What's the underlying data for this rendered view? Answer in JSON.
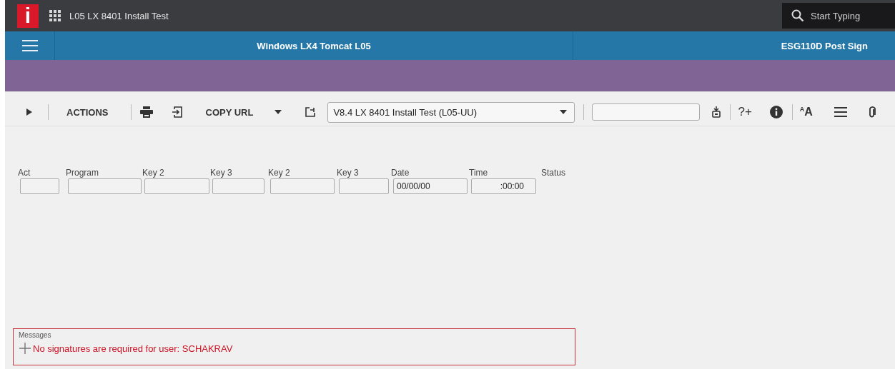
{
  "top_bar": {
    "logo": "i",
    "title": "L05 LX 8401 Install Test",
    "search": {
      "placeholder": "Start Typing"
    }
  },
  "nav_bar": {
    "center_title": "Windows LX4 Tomcat L05",
    "right_title": "ESG110D Post Sign"
  },
  "toolbar": {
    "actions": "ACTIONS",
    "copy_url": "COPY URL",
    "environment": "V8.4 LX 8401 Install Test (L05-UU)",
    "help": "?+",
    "text_size": {
      "small": "A",
      "large": "A"
    }
  },
  "fields": [
    {
      "label": "Act",
      "kind": "text"
    },
    {
      "label": "Program",
      "kind": "text"
    },
    {
      "label": "Key 2",
      "kind": "text"
    },
    {
      "label": "Key 3",
      "kind": "text"
    },
    {
      "label": "Key 2",
      "kind": "text"
    },
    {
      "label": "Key 3",
      "kind": "text"
    },
    {
      "label": "Date",
      "kind": "text",
      "value": "00/00/00"
    },
    {
      "label": "Time",
      "kind": "time",
      "value": ":00:00"
    },
    {
      "label": "Status",
      "kind": "label"
    }
  ],
  "messages": {
    "title": "Messages",
    "items": [
      "No signatures are required for user: SCHAKRAV"
    ]
  }
}
